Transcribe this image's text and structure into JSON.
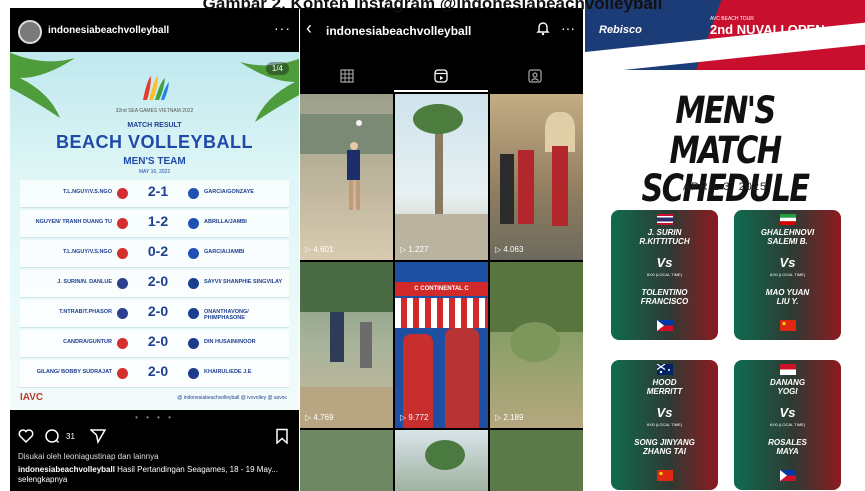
{
  "caption": "Gambar 2. Konten Instagram @indonesiabeachvolleyball",
  "post": {
    "username": "indonesiabeachvolleyball",
    "more": "···",
    "page_indicator": "1/4",
    "games_label": "32nd SEA GAMES VIETNAM 2022",
    "match_result": "MATCH RESULT",
    "title": "BEACH VOLLEYBALL",
    "subtitle": "MEN'S TEAM",
    "date": "MAY 16, 2022",
    "matches": [
      {
        "left": "T.L.NGUY/V.S.NGO",
        "score": "2-1",
        "right": "GARCIA/GONZAYE"
      },
      {
        "left": "NGUYEN/ TRANH DUANG TU",
        "score": "1-2",
        "right": "ABRILLA/JAMBI"
      },
      {
        "left": "T.L.NGUY/V.S.NGO",
        "score": "0-2",
        "right": "GARCIA/JAMBI"
      },
      {
        "left": "J. SURIN/N. DANLUE",
        "score": "2-0",
        "right": "SAYVI/ SHANPHIE SINGVILAY"
      },
      {
        "left": "T.NTRAB/T.PHASOR",
        "score": "2-0",
        "right": "ONANTHAVONG/ PHIMPHASONE"
      },
      {
        "left": "CANDRA/GUNTUR",
        "score": "2-0",
        "right": "DIN HUSAINI/NOOR"
      },
      {
        "left": "GILANG/ BOBBY SUDRAJAT",
        "score": "2-0",
        "right": "KHAIRUL/EDE J.E"
      }
    ],
    "footer_logo": "IAVC",
    "footer_social": "@ indonesiabeachvolleyball   @ ivcvolley   @ asvoc",
    "dots": "• • • •",
    "comment_count": "31",
    "liked_by": "Disukai oleh leoniagustinap dan lainnya",
    "caption_user": "indonesiabeachvolleyball",
    "caption_text": "Hasil Pertandingan Seagames, 18 - 19 May... selengkapnya"
  },
  "profile": {
    "username": "indonesiabeachvolleyball",
    "more": "···",
    "reels": [
      {
        "views": "▷ 4.601"
      },
      {
        "views": "▷ 1.227"
      },
      {
        "views": "▷ 4.063"
      },
      {
        "views": "▷ 4.769"
      },
      {
        "views": "▷ 9.772"
      },
      {
        "views": "▷ 2.189"
      }
    ],
    "banner_text": "C CONTINENTAL C"
  },
  "schedule": {
    "sponsor": "Rebisco",
    "tour_label": "AVC BEACH TOUR",
    "event": "2nd NUVALI OPEN",
    "city": "CITY OF SANTA ROSA, LAGUNA, PHILIPPINES",
    "title_line1": "MEN'S",
    "title_line2": "MATCH SCHEDULE",
    "date": "APRIL 3, 2025",
    "cards": [
      {
        "team1": "J. SURIN\nR.KITTITUCH",
        "vs": "Vs",
        "time": "8:00 (LOCAL TIME)",
        "team2": "TOLENTINO\nFRANCISCO",
        "flag1": "thailand",
        "flag2": "philippines"
      },
      {
        "team1": "GHALEHNOVI\nSALEMI B.",
        "vs": "Vs",
        "time": "8:00 (LOCAL TIME)",
        "team2": "MAO YUAN\nLIU Y.",
        "flag1": "iran",
        "flag2": "china"
      },
      {
        "team1": "HOOD\nMERRITT",
        "vs": "Vs",
        "time": "8:00 (LOCAL TIME)",
        "team2": "SONG JINYANG\nZHANG TAI",
        "flag1": "australia",
        "flag2": "china"
      },
      {
        "team1": "DANANG\nYOGI",
        "vs": "Vs",
        "time": "8:00 (LOCAL TIME)",
        "team2": "ROSALES\nMAYA",
        "flag1": "indonesia",
        "flag2": "philippines"
      }
    ]
  },
  "colors": {
    "instagram_bg": "#000000",
    "post_title": "#1f4aa8",
    "card_green": "#0f6b4f",
    "card_red": "#8e1a1f",
    "banner_blue": "#1c3c78",
    "banner_red": "#c8102e"
  }
}
